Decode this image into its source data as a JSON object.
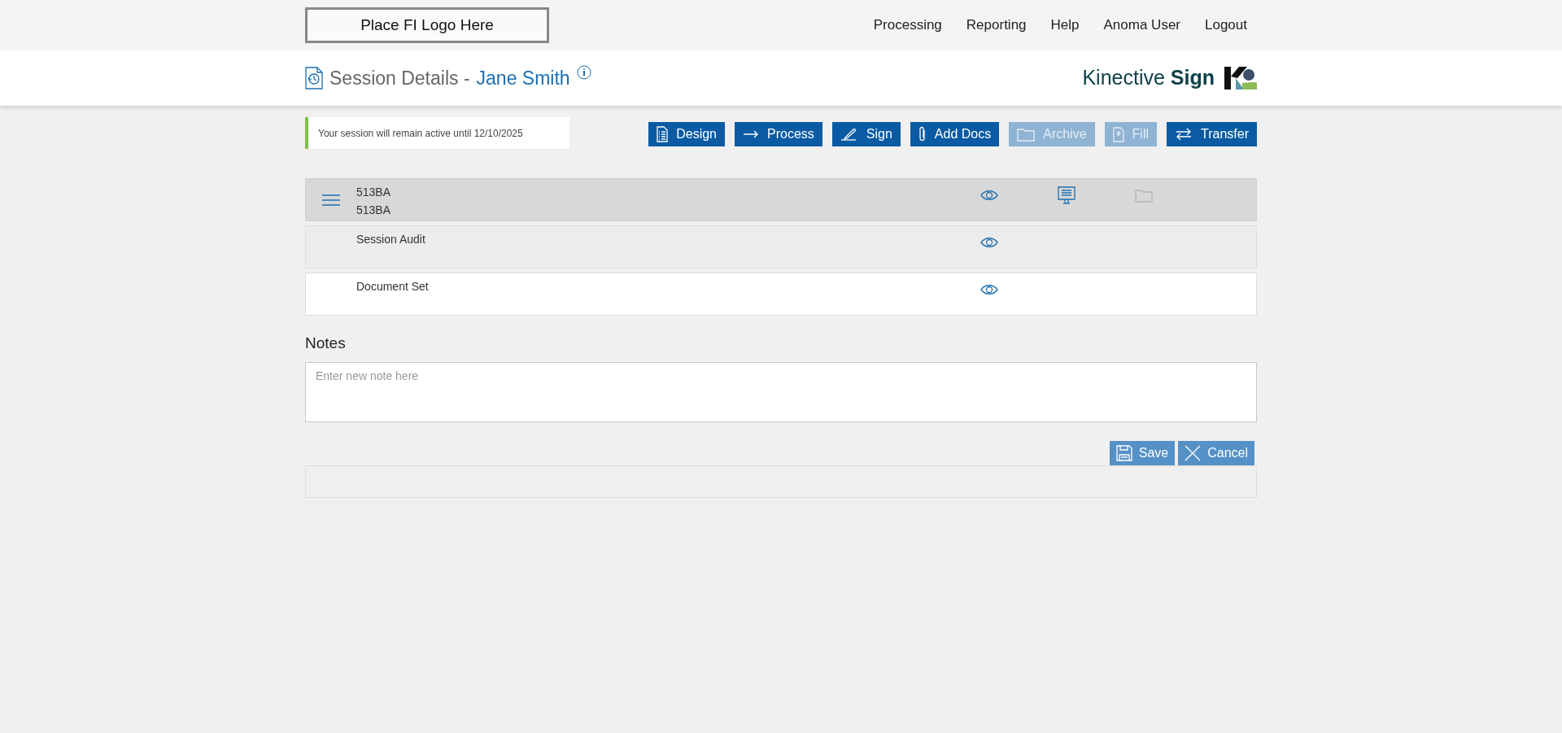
{
  "logo_placeholder": "Place FI Logo Here",
  "nav": [
    "Processing",
    "Reporting",
    "Help",
    "Anoma User",
    "Logout"
  ],
  "page_header": {
    "title": "Session Details -",
    "client_name": "Jane Smith",
    "brand": {
      "light": "Kinective",
      "bold": "Sign"
    }
  },
  "session_notice": "Your session will remain active until 12/10/2025",
  "toolbar": [
    {
      "label": "Design",
      "kind": "design",
      "disabled": false
    },
    {
      "label": "Process",
      "kind": "process",
      "disabled": false
    },
    {
      "label": "Sign",
      "kind": "sign",
      "disabled": false
    },
    {
      "label": "Add Docs",
      "kind": "attach",
      "disabled": false
    },
    {
      "label": "Archive",
      "kind": "archive",
      "disabled": true
    },
    {
      "label": "Fill",
      "kind": "fill",
      "disabled": true
    },
    {
      "label": "Transfer",
      "kind": "transfer",
      "disabled": false
    }
  ],
  "rows": [
    {
      "lines": [
        "513BA",
        "513BA"
      ],
      "selected": true,
      "hovered": false,
      "menu": true,
      "actions": [
        {
          "kind": "view",
          "disabled": false
        },
        {
          "kind": "present",
          "disabled": false
        },
        {
          "kind": "archive",
          "disabled": true
        }
      ]
    },
    {
      "lines": [
        "Session Audit"
      ],
      "selected": false,
      "hovered": true,
      "menu": false,
      "actions": [
        {
          "kind": "view",
          "disabled": false
        }
      ]
    },
    {
      "lines": [
        "Document Set"
      ],
      "selected": false,
      "hovered": false,
      "menu": false,
      "actions": [
        {
          "kind": "view",
          "disabled": false
        }
      ]
    }
  ],
  "notes": {
    "heading": "Notes",
    "placeholder": "Enter new note here",
    "buttons": [
      {
        "label": "Save",
        "kind": "save"
      },
      {
        "label": "Cancel",
        "kind": "cancel"
      }
    ]
  }
}
